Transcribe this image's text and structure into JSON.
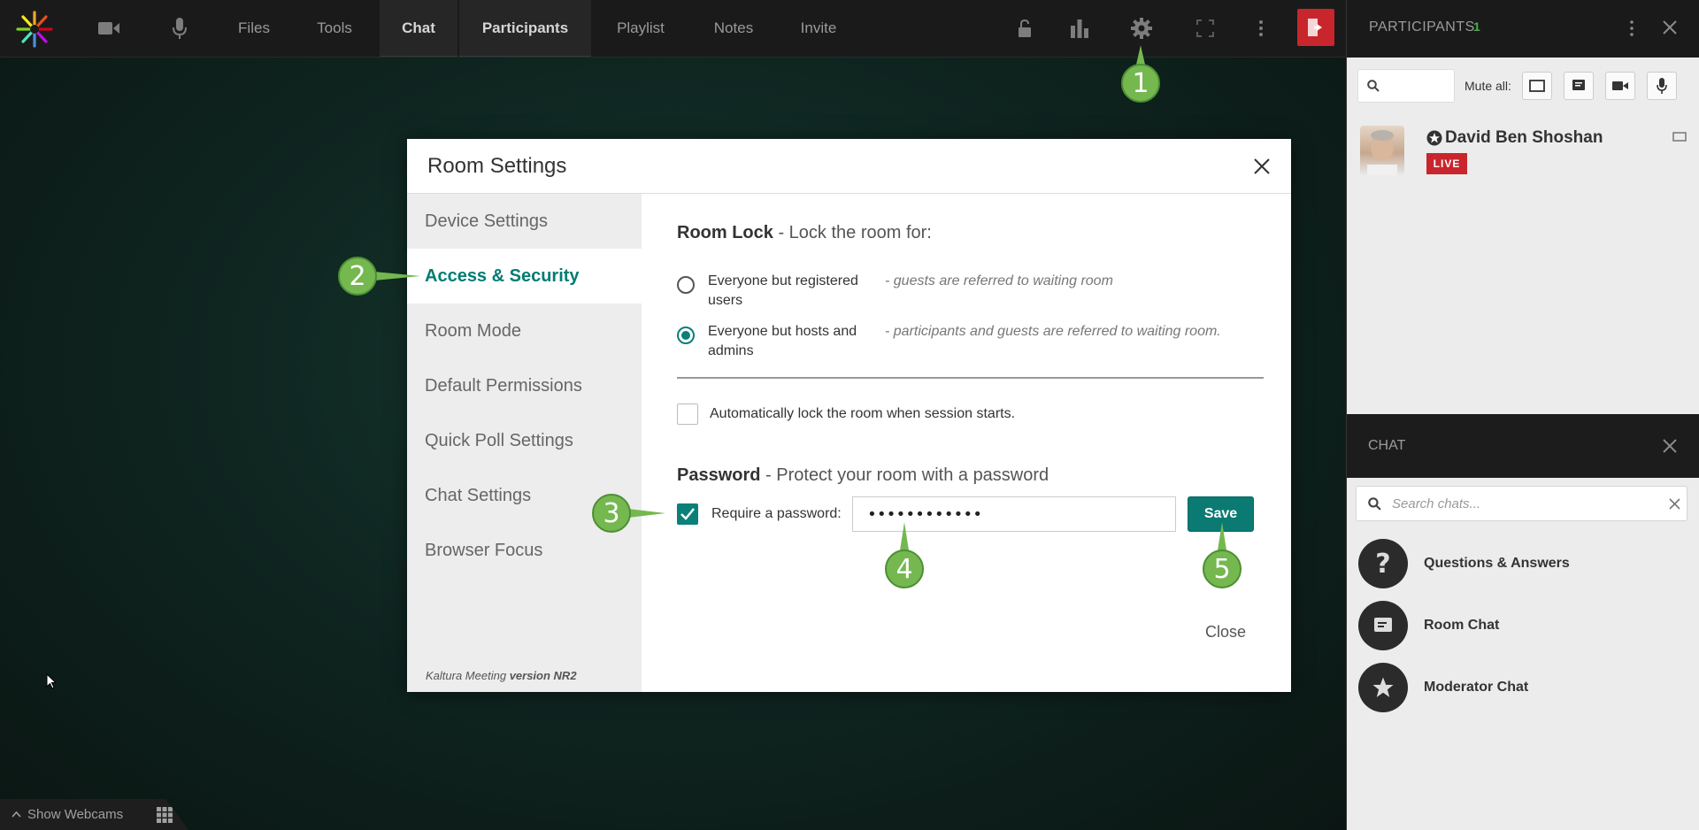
{
  "topbar": {
    "nav": [
      "Files",
      "Tools",
      "Chat",
      "Participants",
      "Playlist",
      "Notes",
      "Invite"
    ],
    "icons": [
      "camera-icon",
      "microphone-icon",
      "lock-icon",
      "poll-icon",
      "gear-icon",
      "fullscreen-icon",
      "more-icon",
      "exit-icon"
    ]
  },
  "participants_panel": {
    "title": "PARTICIPANTS",
    "count": "1",
    "mute_all_label": "Mute all:",
    "participant": {
      "name": "David Ben Shoshan",
      "badge": "LIVE"
    }
  },
  "chat_panel": {
    "title": "CHAT",
    "search_placeholder": "Search chats...",
    "items": [
      "Questions & Answers",
      "Room Chat",
      "Moderator Chat"
    ]
  },
  "modal": {
    "title": "Room Settings",
    "sidebar": [
      "Device Settings",
      "Access & Security",
      "Room Mode",
      "Default Permissions",
      "Quick Poll Settings",
      "Chat Settings",
      "Browser Focus"
    ],
    "version_prefix": "Kaltura Meeting",
    "version": "version NR2",
    "room_lock": {
      "title": "Room Lock",
      "subtitle": " - Lock the room for:",
      "options": [
        {
          "label": "Everyone but registered users",
          "desc": "- guests are referred to waiting room",
          "checked": false
        },
        {
          "label": "Everyone but hosts and admins",
          "desc": "- participants and guests are referred to waiting room.",
          "checked": true
        }
      ],
      "auto_lock_label": "Automatically lock the room when session starts.",
      "auto_lock_checked": false
    },
    "password": {
      "title": "Password",
      "subtitle": " - Protect your room with a password",
      "require_label": "Require a password:",
      "require_checked": true,
      "value": "••••••••••••",
      "save_label": "Save"
    },
    "close_label": "Close"
  },
  "callouts": [
    "1",
    "2",
    "3",
    "4",
    "5"
  ],
  "bottom": {
    "show_webcams": "Show Webcams"
  },
  "colors": {
    "accent": "#0a7a72",
    "live": "#c8262c",
    "callout": "#74b84f"
  }
}
